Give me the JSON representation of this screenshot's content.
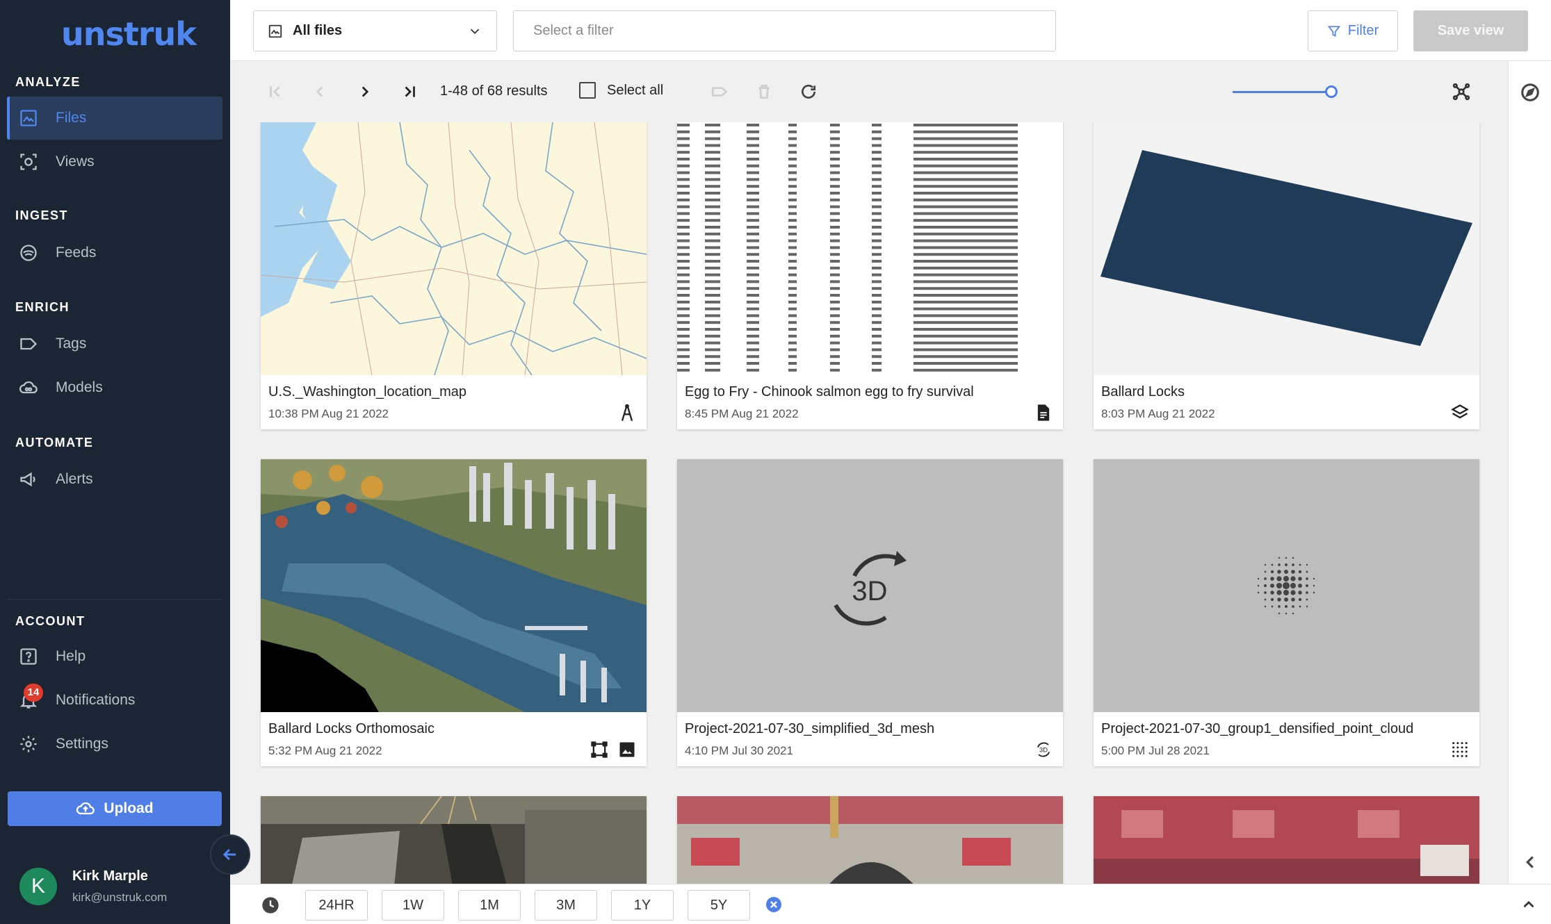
{
  "brand": {
    "logo_text": "unstruk",
    "accent": "#4f86f0",
    "sidebar_bg": "#1b2533"
  },
  "sidebar": {
    "sections": {
      "analyze": "ANALYZE",
      "ingest": "INGEST",
      "enrich": "ENRICH",
      "automate": "AUTOMATE",
      "account": "ACCOUNT"
    },
    "items": {
      "files": {
        "label": "Files",
        "icon": "image-icon",
        "active": true
      },
      "views": {
        "label": "Views",
        "icon": "camera-scan-icon"
      },
      "feeds": {
        "label": "Feeds",
        "icon": "feed-icon"
      },
      "tags": {
        "label": "Tags",
        "icon": "tag-icon"
      },
      "models": {
        "label": "Models",
        "icon": "cloud-brain-icon"
      },
      "alerts": {
        "label": "Alerts",
        "icon": "megaphone-icon"
      },
      "help": {
        "label": "Help",
        "icon": "help-icon"
      },
      "notifications": {
        "label": "Notifications",
        "icon": "bell-icon",
        "badge": "14"
      },
      "settings": {
        "label": "Settings",
        "icon": "gear-icon"
      }
    },
    "upload_label": "Upload",
    "user": {
      "initial": "K",
      "name": "Kirk Marple",
      "email": "kirk@unstruk.com"
    }
  },
  "topbar": {
    "files_select": "All files",
    "filter_placeholder": "Select a filter",
    "filter_label": "Filter",
    "save_view_label": "Save view"
  },
  "toolbar": {
    "results": "1-48 of 68 results",
    "select_all": "Select all",
    "thumbnail_size_fraction": 1.0
  },
  "cards": [
    {
      "title": "U.S._Washington_location_map",
      "date": "10:38 PM Aug 21 2022",
      "type_icon": "vector-pen-icon"
    },
    {
      "title": "Egg to Fry - Chinook salmon egg to fry survival",
      "date": "8:45 PM Aug 21 2022",
      "type_icon": "document-icon"
    },
    {
      "title": "Ballard Locks",
      "date": "8:03 PM Aug 21 2022",
      "type_icon": "layers-icon"
    },
    {
      "title": "Ballard Locks Orthomosaic",
      "date": "5:32 PM Aug 21 2022",
      "type_icon": "image-icon"
    },
    {
      "title": "Project-2021-07-30_simplified_3d_mesh",
      "date": "4:10 PM Jul 30 2021",
      "type_icon": "3d-rotate-icon"
    },
    {
      "title": "Project-2021-07-30_group1_densified_point_cloud",
      "date": "5:00 PM Jul 28 2021",
      "type_icon": "point-cloud-icon"
    }
  ],
  "thumb_text": {
    "three_d": "3D"
  },
  "time_ranges": [
    "24HR",
    "1W",
    "1M",
    "3M",
    "1Y",
    "5Y"
  ]
}
